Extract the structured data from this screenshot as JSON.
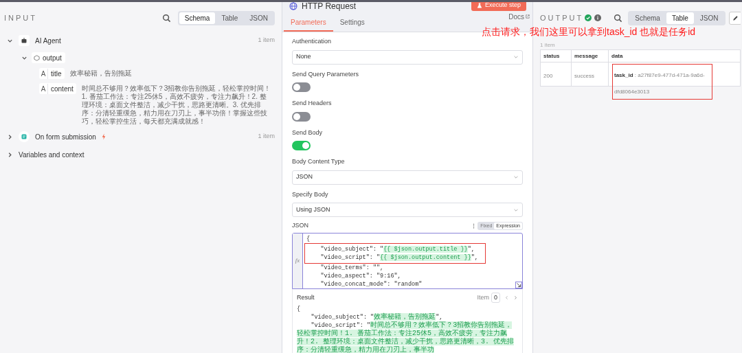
{
  "input": {
    "heading": "INPUT",
    "view_tabs": [
      {
        "label": "Schema",
        "selected": true
      },
      {
        "label": "Table",
        "selected": false
      },
      {
        "label": "JSON",
        "selected": false
      }
    ],
    "tree": [
      {
        "kind": "agent",
        "label": "AI Agent",
        "count": "1 item",
        "expanded": true,
        "children": [
          {
            "label": "output",
            "expanded": true,
            "fields": [
              {
                "type_icon": "A",
                "name": "title",
                "value": "效率秘籍，告别拖延"
              },
              {
                "type_icon": "A",
                "name": "content",
                "value": "时间总不够用？效率低下？3招教你告别拖延，轻松掌控时间！1. 番茄工作法：专注25休5，高效不疲劳，专注力飙升！2. 整理环境：桌面文件整洁，减少干扰，思路更清晰。3. 优先排序：分清轻重缓急，精力用在刀刃上，事半功倍！掌握这些技巧，轻松掌控生活，每天都充满成就感！"
              }
            ]
          }
        ]
      },
      {
        "kind": "form",
        "label": "On form submission",
        "count": "1 item",
        "expanded": false
      }
    ],
    "variables": {
      "label": "Variables and context",
      "expanded": false
    }
  },
  "node": {
    "title": "HTTP Request",
    "execute": "Execute step",
    "tabs": [
      {
        "label": "Parameters",
        "selected": true
      },
      {
        "label": "Settings",
        "selected": false
      }
    ],
    "docs": "Docs",
    "params": [
      {
        "kind": "select",
        "label": "Authentication",
        "value": "None"
      },
      {
        "kind": "toggle",
        "label": "Send Query Parameters",
        "on": false
      },
      {
        "kind": "toggle",
        "label": "Send Headers",
        "on": false
      },
      {
        "kind": "toggle",
        "label": "Send Body",
        "on": true
      },
      {
        "kind": "select",
        "label": "Body Content Type",
        "value": "JSON"
      },
      {
        "kind": "select",
        "label": "Specify Body",
        "value": "Using JSON"
      }
    ],
    "json": {
      "label": "JSON",
      "modes": [
        {
          "label": "Fixed",
          "selected": false
        },
        {
          "label": "Expression",
          "selected": true
        }
      ],
      "fx": "fx",
      "lines": [
        {
          "kind": "plain",
          "text": "{"
        },
        {
          "kind": "expression",
          "prefix": "    \"video_subject\": \"",
          "expr": "{{ $json.output.title }}",
          "suffix": "\","
        },
        {
          "kind": "expression",
          "prefix": "    \"video_script\": \"",
          "expr": "{{ $json.output.content }}",
          "suffix": "\","
        },
        {
          "kind": "plain",
          "text": "    \"video_terms\": \"\","
        },
        {
          "kind": "plain",
          "text": "    \"video_aspect\": \"9:16\","
        },
        {
          "kind": "plain",
          "text": "    \"video_concat_mode\": \"random\""
        }
      ]
    },
    "result": {
      "label": "Result",
      "item_label": "Item",
      "item_value": "0",
      "lines": [
        {
          "kind": "plain",
          "text": "{"
        },
        {
          "kind": "expression",
          "prefix": "    \"video_subject\": \"",
          "expr": "效率秘籍，告别拖延",
          "suffix": "\","
        },
        {
          "kind": "expression",
          "prefix": "    \"video_script\": \"",
          "expr": "时间总不够用？效率低下？3招教你告别拖延，轻松掌控时间！1. 番茄工作法：专注25休5，高效不疲劳，专注力飙升！2. 整理环境：桌面文件整洁，减少干扰，思路更清晰，3. 优先排序：分清轻重缓急，精力用在刀刃上，事半功"
        }
      ]
    }
  },
  "output": {
    "heading": "OUTPUT",
    "view_tabs": [
      {
        "label": "Schema",
        "selected": false
      },
      {
        "label": "Table",
        "selected": true
      },
      {
        "label": "JSON",
        "selected": false
      }
    ],
    "count": "1 item",
    "table": {
      "columns": [
        "status",
        "message",
        "data"
      ],
      "rows": [
        {
          "status": "200",
          "message": "success",
          "data": "**task_id** : a27f87e9-477d-471a-9a6d-dfd8064e3013"
        }
      ]
    }
  },
  "annotation": "点击请求，我们这里可以拿到task_id 也就是任务id"
}
